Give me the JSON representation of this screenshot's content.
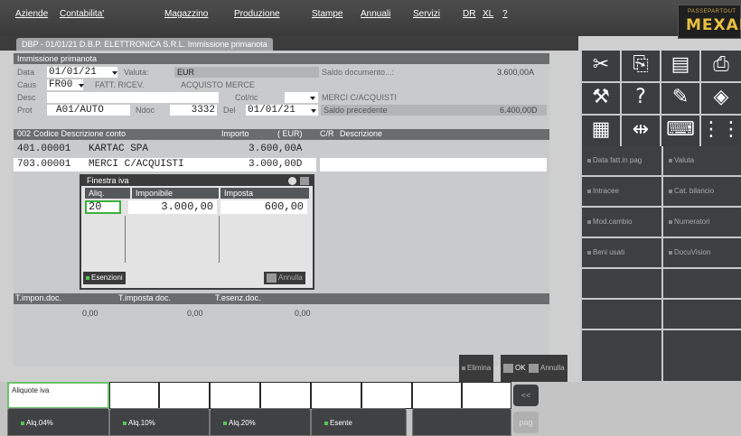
{
  "menubar": {
    "items": [
      "Aziende",
      "Contabilita'",
      "Magazzino",
      "Produzione",
      "Stampe",
      "Annuali",
      "Servizi",
      "DR",
      "XL",
      "?"
    ],
    "logo_small": "PASSEPARTOUT",
    "logo_big": "MEXAL"
  },
  "tab": {
    "label": "DBP - 01/01/21  D.B.P. ELETTRONICA S.R.L.  Immissione primanota"
  },
  "form": {
    "title": "Immissione primanota",
    "data_label": "Data",
    "data_value": "01/01/21",
    "valuta_label": "Valuta:",
    "valuta_value": "EUR",
    "saldo_doc_label": "Saldo documento...:",
    "saldo_doc_value": "3.600,00A",
    "caus_label": "Caus",
    "caus_value": "FR00",
    "caus_desc": "FATT. RICEV.",
    "caus_desc2": "ACQUISTO MERCE",
    "desc_label": "Desc",
    "colric_label": "Col/ric",
    "colric_desc": "MERCI C/ACQUISTI",
    "prot_label": "Prot",
    "prot_value": "A01/AUTO",
    "ndoc_label": "Ndoc",
    "ndoc_value": "3332",
    "del_label": "Del",
    "del_value": "01/01/21",
    "saldo_prec_label": "Saldo precedente",
    "saldo_prec_value": "6.400,00D"
  },
  "grid": {
    "header": {
      "num": "002",
      "codice": "Codice Descrizione conto",
      "importo": "Importo",
      "eur": "( EUR)",
      "cr": "C/R",
      "descr": "Descrizione"
    },
    "rows": [
      {
        "code": "401.00001",
        "name": "KARTAC SPA",
        "amount": "3.600,00A"
      },
      {
        "code": "703.00001",
        "name": "MERCI C/ACQUISTI",
        "amount": "3.000,00D"
      }
    ]
  },
  "iva_window": {
    "title": "Finestra iva",
    "col_aliq": "Aliq.",
    "col_imponibile": "Imponibile",
    "col_imposta": "Imposta",
    "aliq": "20",
    "imponibile": "3.000,00",
    "imposta": "600,00",
    "esenzioni_label": "Esenzioni",
    "annulla_label": "Annulla"
  },
  "totals": {
    "timpon_label": "T.impon.doc.",
    "timposta_label": "T.imposta doc.",
    "tesenz_label": "T.esenz.doc.",
    "timpon_value": "0,00",
    "timposta_value": "0,00",
    "tesenz_value": "0,00"
  },
  "actions": {
    "elimina": "Elimina",
    "ok": "OK",
    "annulla": "Annulla"
  },
  "right_panel": {
    "buttons": [
      "Data fatt.in pag",
      "Valuta",
      "Intracee",
      "Cat. bilancio",
      "Mod.cambio",
      "Numeratori",
      "Beni usati",
      "DocuVision"
    ]
  },
  "bottom": {
    "aliquote_label": "Aliquote iva",
    "back_label": "<<",
    "pag_label": "pag",
    "fkeys": [
      "Alq.04%",
      "Alq.10%",
      "Alq.20%",
      "Esente"
    ]
  }
}
